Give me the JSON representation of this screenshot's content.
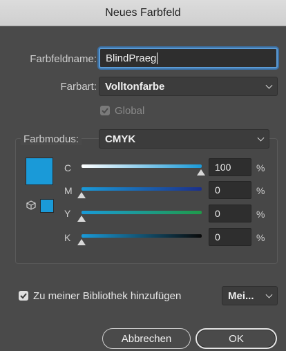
{
  "window": {
    "title": "Neues Farbfeld"
  },
  "form": {
    "name_label": "Farbfeldname:",
    "name_value": "BlindPraeg",
    "type_label": "Farbart:",
    "type_value": "Volltonfarbe",
    "global_label": "Global",
    "global_checked": true
  },
  "color": {
    "mode_label": "Farbmodus:",
    "mode_value": "CMYK",
    "swatch_color": "#1a9ad8",
    "sliders": [
      {
        "label": "C",
        "value": "100",
        "unit": "%",
        "level": 1.0
      },
      {
        "label": "M",
        "value": "0",
        "unit": "%",
        "level": 0.0
      },
      {
        "label": "Y",
        "value": "0",
        "unit": "%",
        "level": 0.0
      },
      {
        "label": "K",
        "value": "0",
        "unit": "%",
        "level": 0.0
      }
    ]
  },
  "library": {
    "add_label": "Zu meiner Bibliothek hinzufügen",
    "add_checked": true,
    "select_value": "Mei..."
  },
  "buttons": {
    "cancel": "Abbrechen",
    "ok": "OK"
  },
  "icons": {
    "cube": "cube-icon",
    "check": "checkmark-icon",
    "chevron": "chevron-down-icon"
  }
}
